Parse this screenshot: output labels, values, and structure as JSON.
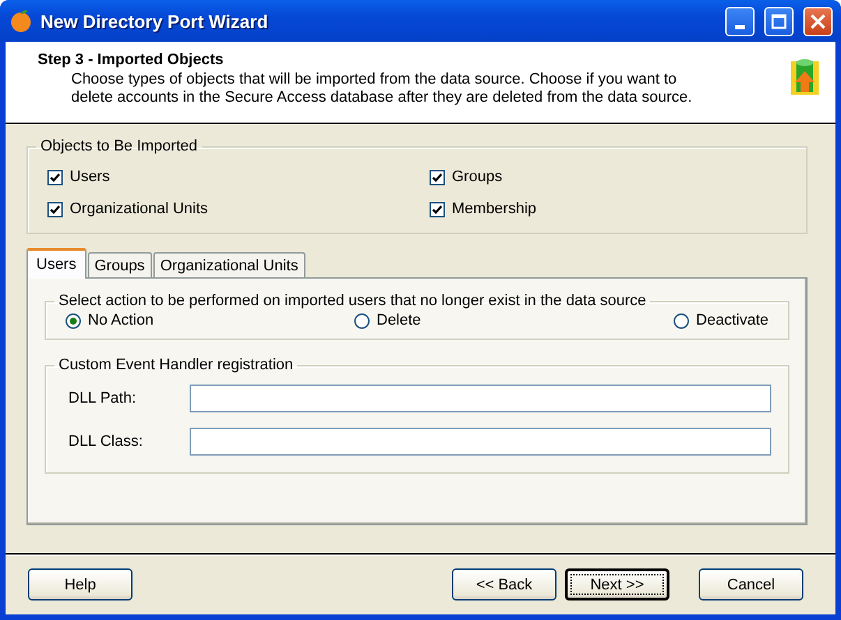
{
  "window": {
    "title": "New Directory Port Wizard"
  },
  "header": {
    "step": "Step 3 - Imported Objects",
    "description": "Choose types of objects that will be imported from the data source. Choose if you want to delete accounts in the Secure Access database after they are deleted  from the data source."
  },
  "objects_group": {
    "title": "Objects to Be Imported",
    "items": [
      {
        "label": "Users",
        "checked": true
      },
      {
        "label": "Groups",
        "checked": true
      },
      {
        "label": "Organizational Units",
        "checked": true
      },
      {
        "label": "Membership",
        "checked": true
      }
    ]
  },
  "tabs": [
    {
      "label": "Users",
      "selected": true
    },
    {
      "label": "Groups",
      "selected": false
    },
    {
      "label": "Organizational Units",
      "selected": false
    }
  ],
  "action_group": {
    "title": "Select action to be performed on imported users that no longer exist in the data source",
    "options": [
      {
        "label": "No Action",
        "selected": true
      },
      {
        "label": "Delete",
        "selected": false
      },
      {
        "label": "Deactivate",
        "selected": false
      }
    ]
  },
  "handler_group": {
    "title": "Custom Event Handler registration",
    "fields": [
      {
        "label": "DLL Path:"
      },
      {
        "label": "DLL Class:"
      }
    ]
  },
  "buttons": [
    {
      "label": "Help",
      "default": false
    },
    {
      "label": "<< Back",
      "default": false
    },
    {
      "label": "Next >>",
      "default": true
    },
    {
      "label": "Cancel",
      "default": false
    }
  ]
}
